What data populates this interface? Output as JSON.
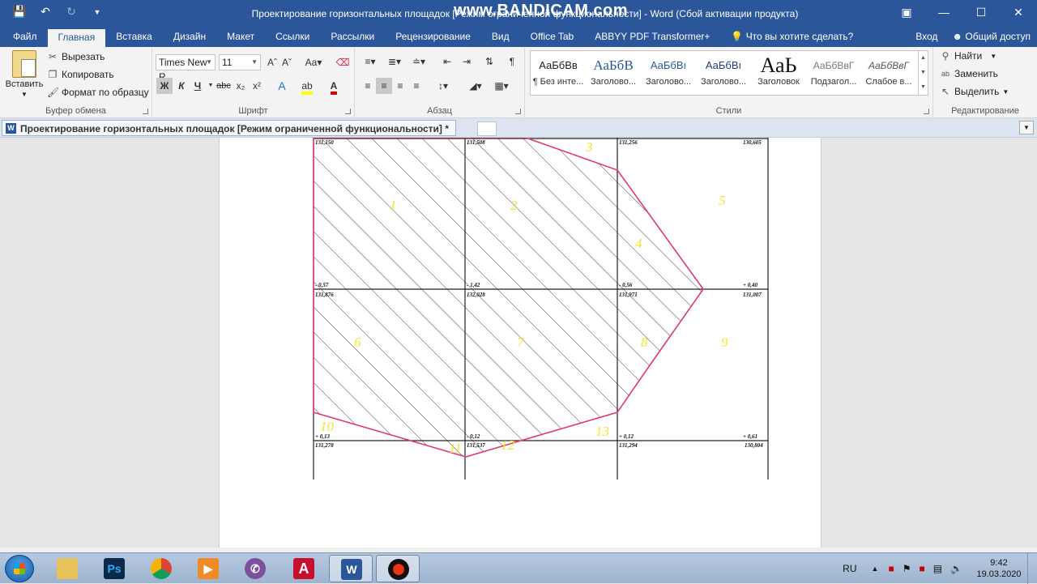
{
  "window": {
    "title": "Проектирование горизонтальных площадок [Режим ограниченной функциональности] - Word (Сбой активации продукта)",
    "watermark": "www.BANDICAM.com"
  },
  "tabs": [
    "Файл",
    "Главная",
    "Вставка",
    "Дизайн",
    "Макет",
    "Ссылки",
    "Рассылки",
    "Рецензирование",
    "Вид",
    "Office Tab",
    "ABBYY PDF Transformer+"
  ],
  "tell_me": "Что вы хотите сделать?",
  "sign_in": "Вход",
  "share": "Общий доступ",
  "clipboard": {
    "paste": "Вставить",
    "cut": "Вырезать",
    "copy": "Копировать",
    "format_painter": "Формат по образцу",
    "label": "Буфер обмена"
  },
  "font": {
    "name": "Times New R",
    "size": "11",
    "label": "Шрифт",
    "bold": "Ж",
    "italic": "К",
    "underline": "Ч",
    "strike": "abc",
    "sub": "x₂",
    "sup": "x²"
  },
  "paragraph": {
    "label": "Абзац"
  },
  "styles": {
    "label": "Стили",
    "items": [
      {
        "sample": "АаБбВв",
        "name": "¶ Без инте..."
      },
      {
        "sample": "АаБбВ",
        "name": "Заголово..."
      },
      {
        "sample": "АаБбВı",
        "name": "Заголово..."
      },
      {
        "sample": "АаБбВı",
        "name": "Заголово..."
      },
      {
        "sample": "АаЬ",
        "name": "Заголовок"
      },
      {
        "sample": "АаБбВвГ",
        "name": "Подзагол..."
      },
      {
        "sample": "АаБбВвГ",
        "name": "Слабое в..."
      }
    ]
  },
  "editing": {
    "find": "Найти",
    "replace": "Заменить",
    "select": "Выделить",
    "label": "Редактирование"
  },
  "doc_tab": "Проектирование горизонтальных площадок [Режим ограниченной функциональности] *",
  "plan": {
    "top_marks": [
      "131,150",
      "131,508",
      "131,256",
      "130,605"
    ],
    "mid_work": [
      "- 0,57",
      "- 1,42",
      "- 0,56",
      "+ 0,40"
    ],
    "mid_marks": [
      "131,876",
      "132,028",
      "131,971",
      "131,007"
    ],
    "bot_work": [
      "+ 0,13",
      "- 0,12",
      "+ 0,12",
      "+ 0,61"
    ],
    "bot_marks": [
      "131,278",
      "131,537",
      "131,294",
      "130,804"
    ],
    "zones": [
      "1",
      "2",
      "3",
      "4",
      "5",
      "6",
      "7",
      "8",
      "9",
      "10",
      "11",
      "12",
      "13"
    ]
  },
  "taskbar": {
    "apps": [
      "Ps",
      "A",
      "W"
    ],
    "lang": "RU",
    "time": "9:42",
    "date": "19.03.2020"
  },
  "colors": {
    "accent": "#2b579a",
    "boundary": "#e0396a",
    "zone_label": "#f5e52a"
  }
}
